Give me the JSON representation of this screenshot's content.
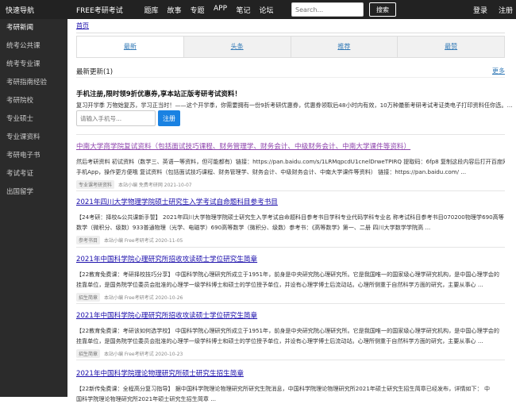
{
  "topbar": {
    "brand": "快速导航",
    "site_title": "FREE考研考试",
    "nav": [
      "题库",
      "故事",
      "专题",
      "APP",
      "笔记",
      "论坛"
    ],
    "search_placeholder": "Search...",
    "search_button": "搜索",
    "login": "登录",
    "register": "注册"
  },
  "sidebar": {
    "items": [
      "考研新闻",
      "统考公共课",
      "统考专业课",
      "考研指南经验",
      "考研院校",
      "专业硕士",
      "专业课资料",
      "考研电子书",
      "考试考证",
      "出国留学"
    ]
  },
  "breadcrumb": "首页",
  "tabs": [
    "最新",
    "头条",
    "推荐",
    "最赞"
  ],
  "updates": {
    "title": "最新更新(1)",
    "more": "更多"
  },
  "promo": {
    "title": "手机注册,限时领9折优惠券,享本站正版考研考试资料！",
    "text": "复习开学季 万物始复苏，学习正当时！——这个开学季，你需要拥有一份9折考研优惠券，优惠券领取后48小时内有效，10万种最新考研考试考证类电子打印资料任你选。...",
    "phone_placeholder": "请输入手机号...",
    "register_button": "注册"
  },
  "articles": [
    {
      "title": "中南大学商学院复试资料（包括面试技巧课程、财务管理学、财务会计、中级财务会计、中南大学课件等资料）",
      "lines": [
        "然后考研资料 初试资料（数学三、英语一等资料，但可能都有）链接：https://pan.baidu.com/s/1LRMqpcdU1cnelDrweTPIRQ 提取码：6fp8 复制这段内容后打开百度网盘",
        "手机App，操作更方便哦 复试资料（包括面试技巧课程、财务管理学、财务会计、中级财务会计、中南大学课件等资料）  链接：https://pan.baidu.com/ ..."
      ],
      "tag": "专业课考研资料",
      "meta": "本站小编 免费考研网 2021-10-07"
    },
    {
      "title": "2021年四川大学物理学院硕士研究生入学考试自命题科目参考书目",
      "lines": [
        "【24考研：择校&公共课新手誓】        2021年四川大学物理学院硕士研究生入学考试自命题科目参考书目学科专业代码学科专业名 称考试科目参考书目070200物理学690高等",
        "数学（微积分、级数）933普通物理（光学、电磁学）690高等数学（微积分、级数）参考书：《高等数学》第一、二册 四川大学数学学院高 ..."
      ],
      "tag": "参考书目",
      "meta": "本站小编 Free考研考试 2020-11-05"
    },
    {
      "title": "2021年中国科学院心理研究所招收攻读硕士学位研究生简章",
      "lines": [
        "【22教育免费课：考研择校技巧分享】        中国科学院心理研究所成立于1951年，前身是中央研究院心理研究所。它是我国唯一的国家级心理学研究机构，是中国心理学会的",
        "挂靠单位，是国务院学位委员会批准的心理学一级学科博士和硕士的学位授予单位，并设有心理学博士后流动站。心理所侧重于自然科学方面的研究，主要从事心 ..."
      ],
      "tag": "招生简章",
      "meta": "本站小编 Free考研考试 2020-10-26"
    },
    {
      "title": "2021年中国科学院心理研究所招收攻读硕士学位研究生简章",
      "lines": [
        "【22教育免费课：考研该如何选学校】        中国科学院心理研究所成立于1951年，前身是中央研究院心理研究所。它是我国唯一的国家级心理学研究机构，是中国心理学会的",
        "挂靠单位，是国务院学位委员会批准的心理学一级学科博士和硕士的学位授予单位，并设有心理学博士后流动站。心理所侧重于自然科学方面的研究，主要从事心 ..."
      ],
      "tag": "招生简章",
      "meta": "本站小编 Free考研考试 2020-10-23"
    },
    {
      "title": "2021年中国科学院理论物理研究所硕士研究生招生简章",
      "lines": [
        "【22新传免费课：全程高分复习指导】    据中国科学院理论物理研究所研究生院消息，中国科学院理论物理研究所2021年硕士研究生招生简章已经发布，详情如下：       中",
        "国科学院理论物理研究所2021年硕士研究生招生简章 ..."
      ],
      "tag": "招生简章",
      "meta": ""
    }
  ]
}
